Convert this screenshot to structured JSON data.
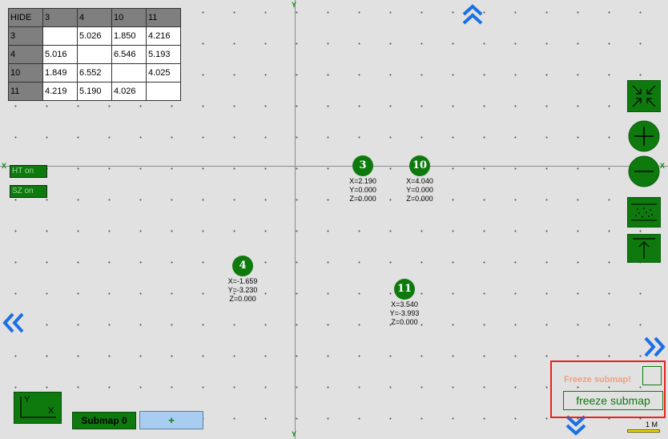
{
  "axes": {
    "y_label": "Y",
    "x_label": "X"
  },
  "distance_table": {
    "corner": "HIDE",
    "headers": [
      "3",
      "4",
      "10",
      "11"
    ],
    "rows": [
      {
        "id": "3",
        "cells": [
          "",
          "5.026",
          "1.850",
          "4.216"
        ]
      },
      {
        "id": "4",
        "cells": [
          "5.016",
          "",
          "6.546",
          "5.193"
        ]
      },
      {
        "id": "10",
        "cells": [
          "1.849",
          "6.552",
          "",
          "4.025"
        ]
      },
      {
        "id": "11",
        "cells": [
          "4.219",
          "5.190",
          "4.026",
          ""
        ]
      }
    ]
  },
  "toggles": {
    "ht": "HT on",
    "sz": "SZ on"
  },
  "nodes": [
    {
      "label": "3",
      "x": "X=2.190",
      "y": "Y=0.000",
      "z": "Z=0.000"
    },
    {
      "label": "10",
      "x": "X=4.040",
      "y": "Y=0.000",
      "z": "Z=0.000"
    },
    {
      "label": "4",
      "x": "X=-1.659",
      "y": "Y=-3.230",
      "z": "Z=0.000"
    },
    {
      "label": "11",
      "x": "X=3.540",
      "y": "Y=-3.993",
      "z": "Z=0.000"
    }
  ],
  "freeze": {
    "warning": "Freeze submap!",
    "button": "freeze submap"
  },
  "submap": {
    "label": "Submap 0",
    "add": "+"
  },
  "scale": {
    "label": "1 M"
  },
  "xy_icon": {
    "y": "Y",
    "x": "X"
  },
  "colors": {
    "accent": "#0e7a0e",
    "nav": "#1a6fe6",
    "alert": "#e8221e",
    "background": "#e1e1e1"
  }
}
